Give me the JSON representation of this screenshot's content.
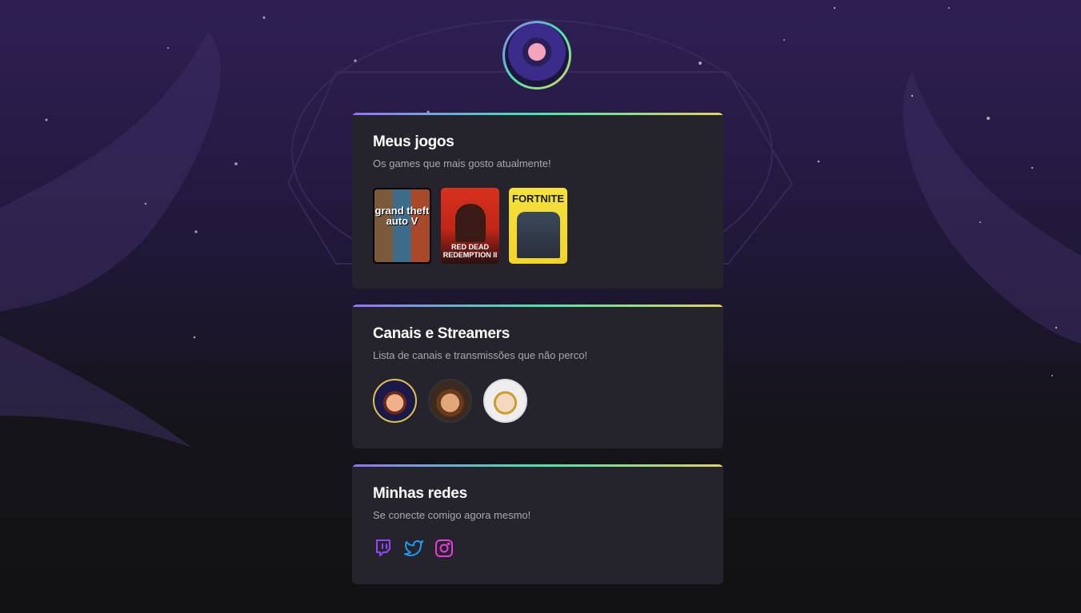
{
  "profile": {
    "avatar": "profile-avatar"
  },
  "games_card": {
    "title": "Meus jogos",
    "subtitle": "Os games que mais gosto atualmente!",
    "games": [
      {
        "title": "grand theft auto V",
        "icon": "gta-cover"
      },
      {
        "title": "RED DEAD REDEMPTION II",
        "icon": "rdr2-cover"
      },
      {
        "title": "FORTNITE",
        "icon": "fortnite-cover"
      }
    ]
  },
  "streamers_card": {
    "title": "Canais e Streamers",
    "subtitle": "Lista de canais e transmissões que não perco!",
    "streamers": [
      {
        "icon": "streamer-avatar-1"
      },
      {
        "icon": "streamer-avatar-2"
      },
      {
        "icon": "streamer-avatar-3"
      }
    ]
  },
  "socials_card": {
    "title": "Minhas redes",
    "subtitle": "Se conecte comigo agora mesmo!",
    "links": [
      {
        "icon": "twitch-icon",
        "color": "#9146ff"
      },
      {
        "icon": "twitter-icon",
        "color": "#1d9bf0"
      },
      {
        "icon": "instagram-icon",
        "color": "#e43fd8"
      }
    ]
  },
  "colors": {
    "card_bg": "#25232c",
    "gradient": [
      "#9572fc",
      "#43e7ad",
      "#e2d45c"
    ],
    "page_top": "#2e1f52",
    "page_bottom": "#121214"
  }
}
